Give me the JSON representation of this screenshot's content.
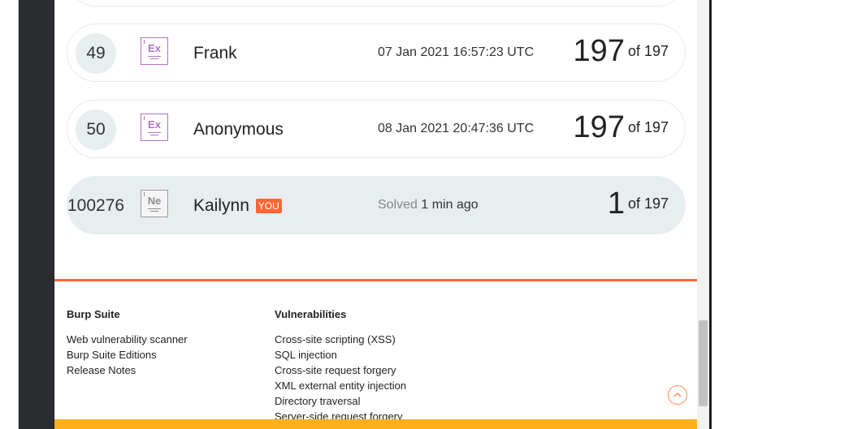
{
  "leaderboard": {
    "rows": [
      {
        "rank": "49",
        "badge": "Ex",
        "name": "Frank",
        "date": "07 Jan 2021 16:57:23 UTC",
        "score": "197",
        "of_text": "of 197"
      },
      {
        "rank": "50",
        "badge": "Ex",
        "name": "Anonymous",
        "date": "08 Jan 2021 20:47:36 UTC",
        "score": "197",
        "of_text": "of 197"
      }
    ],
    "me": {
      "rank": "100276",
      "badge": "Ne",
      "name": "Kailynn",
      "you_tag": "YOU",
      "solved_label": "Solved",
      "solved_time": "1 min ago",
      "score": "1",
      "of_text": "of 197"
    }
  },
  "footer": {
    "col1": {
      "heading": "Burp Suite",
      "links": [
        "Web vulnerability scanner",
        "Burp Suite Editions",
        "Release Notes"
      ]
    },
    "col2": {
      "heading": "Vulnerabilities",
      "links": [
        "Cross-site scripting (XSS)",
        "SQL injection",
        "Cross-site request forgery",
        "XML external entity injection",
        "Directory traversal",
        "Server-side request forgery"
      ]
    }
  },
  "icons": {
    "scroll_top": "chevron-up-icon"
  },
  "colors": {
    "accent": "#ff6633",
    "badge_expert": "#b074c4",
    "badge_novice": "#8d8d8d",
    "footer_bar": "#ffb11a"
  }
}
